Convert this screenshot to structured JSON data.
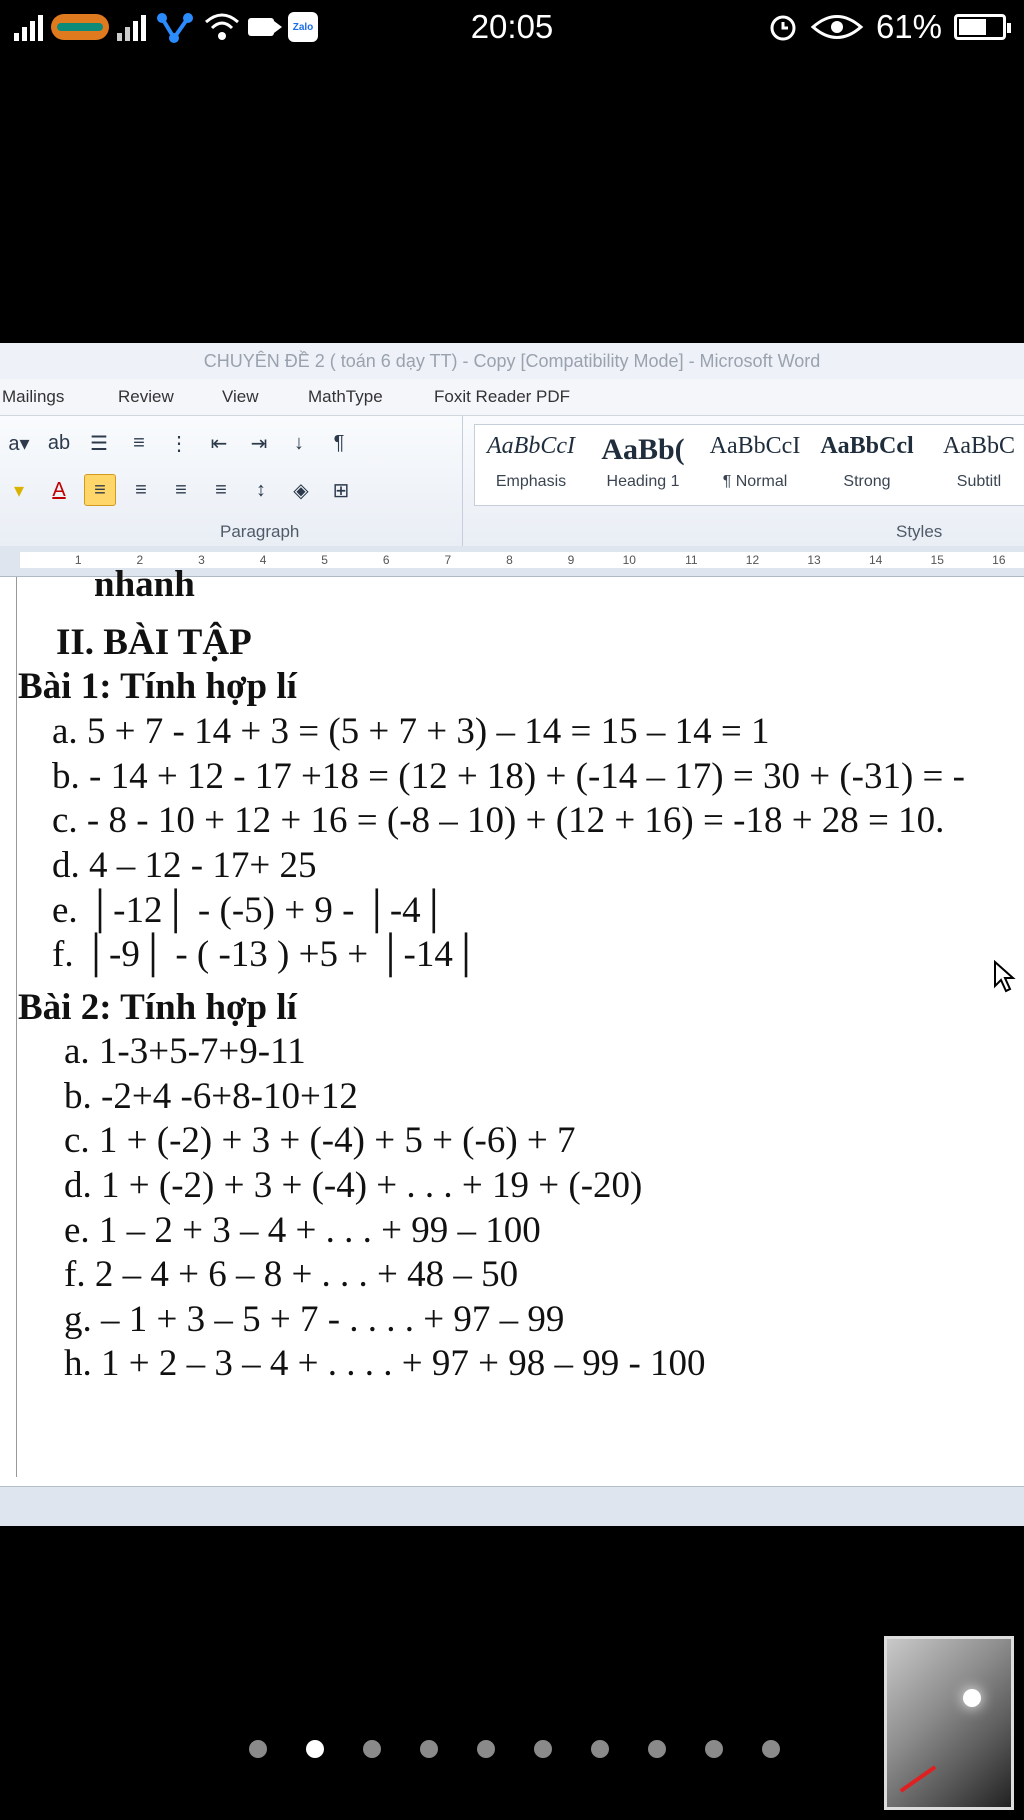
{
  "status_bar": {
    "time": "20:05",
    "battery_percent": "61%",
    "battery_level": 0.61,
    "icons": [
      "signal-icon",
      "carrier-icon",
      "signal-icon",
      "app-icon",
      "wifi-icon",
      "video-icon",
      "zalo-icon",
      "alarm-icon",
      "eye-icon",
      "battery-icon"
    ],
    "zalo_label": "Zalo"
  },
  "word": {
    "title": "CHUYÊN ĐỀ 2 ( toán 6 dạy TT) - Copy [Compatibility Mode]  -  Microsoft Word",
    "tabs": [
      "Mailings",
      "Review",
      "View",
      "MathType",
      "Foxit Reader PDF"
    ],
    "paragraph_group_label": "Paragraph",
    "styles_group_label": "Styles",
    "styles": [
      {
        "preview": "AaBbCcI",
        "name": "Emphasis"
      },
      {
        "preview": "AaBb(",
        "name": "Heading 1"
      },
      {
        "preview": "AaBbCcI",
        "name": "¶ Normal"
      },
      {
        "preview": "AaBbCcl",
        "name": "Strong"
      },
      {
        "preview": "AaBbC",
        "name": "Subtitl"
      }
    ],
    "ruler_numbers": [
      "1",
      "2",
      "3",
      "4",
      "5",
      "6",
      "7",
      "8",
      "9",
      "10",
      "11",
      "12",
      "13",
      "14",
      "15",
      "16"
    ]
  },
  "document": {
    "top_fragment": "nhanh",
    "section_heading": "II. BÀI TẬP",
    "bai1": {
      "title": "Bài 1: Tính hợp lí",
      "items": [
        "a.  5 + 7  - 14 + 3 = (5 + 7 + 3) – 14 = 15 – 14 = 1",
        "b.  - 14 + 12 - 17 +18 = (12 + 18) + (-14 – 17) = 30 + (-31) = -",
        "c.  - 8 - 10 + 12 + 16 = (-8 – 10) + (12 + 16) = -18 + 28 = 10.",
        "d.  4 – 12 - 17+ 25",
        "e.  │-12│ - (-5) + 9 -  │-4│",
        "f.  │-9│ - ( -13 ) +5 + │-14│"
      ]
    },
    "bai2": {
      "title": "Bài 2: Tính hợp lí",
      "items": [
        "a.  1-3+5-7+9-11",
        "b.  -2+4 -6+8-10+12",
        "c.  1 + (-2) + 3 + (-4) + 5 + (-6) + 7",
        "d.  1 + (-2) + 3 + (-4) + . . . + 19 + (-20)",
        "e.  1 – 2 + 3 – 4 + . . . + 99 – 100",
        "f.  2 – 4 + 6 – 8 + . . . + 48 – 50",
        "g.  – 1 + 3 – 5 + 7 - . . . . + 97 – 99",
        "h.  1 + 2 – 3 – 4 + . . . . + 97 + 98 – 99 - 100"
      ]
    }
  },
  "page_indicator": {
    "count": 10,
    "active_index": 1
  }
}
